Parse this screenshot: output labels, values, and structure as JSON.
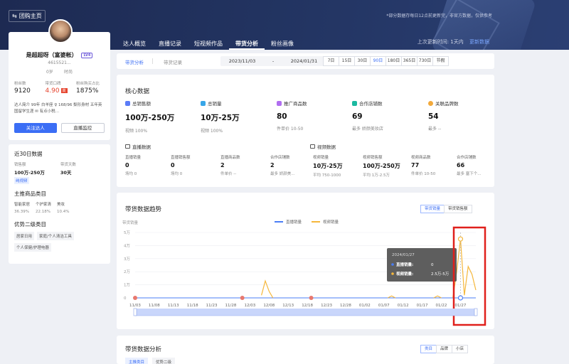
{
  "header": {
    "back_label": "团购主页",
    "notice": "*部分数据存每日12点前更新完，非官方数据，仅供参考",
    "tabs": [
      "达人概览",
      "直播记录",
      "短视频作品",
      "带货分析",
      "粉丝画像"
    ],
    "active_tab": 3,
    "last_update_label": "上次更新时间:",
    "last_update_value": "1天内",
    "update_link": "更新数据"
  },
  "profile": {
    "name": "是超超呀（富婆帐）",
    "level": "LV4",
    "uid": "4615521...",
    "sub_left": "0岁",
    "sub_right": "时尚",
    "stats": [
      {
        "label": "粉丝数",
        "value": "9120"
      },
      {
        "label": "带货口碑",
        "value": "4.90",
        "badge": "高"
      },
      {
        "label": "粉丝购买占比",
        "value": "1875%"
      }
    ],
    "bio": "达人简介 99年 白羊座 ♀ 168/96 梨形身材 五年英国留学生涯 ✉ 有点小税…",
    "follow_btn": "关注达人",
    "live_btn": "直播监控"
  },
  "summary30": {
    "title": "近30日数据",
    "sales_label": "销售额",
    "sales_value": "100万-250万",
    "days_label": "带货天数",
    "days_value": "30天",
    "chip": "纯视频",
    "main_cat_title": "主推商品类目",
    "main_cats": [
      {
        "name": "智能家居",
        "pct": "36.39%"
      },
      {
        "name": "个护家清",
        "pct": "22.18%"
      },
      {
        "name": "美妆",
        "pct": "10.4%"
      }
    ],
    "sub_cat_title": "优势二级类目",
    "sub_cats": [
      "居家日用",
      "家庭/个人清洁工具",
      "个人保健/护理电器"
    ]
  },
  "filter": {
    "tab_active": "带货分析",
    "tab_inactive": "带货记录",
    "date_start": "2023/11/03",
    "date_sep": "-",
    "date_end": "2024/01/31",
    "periods": [
      "7日",
      "15日",
      "30日",
      "90日",
      "180日",
      "365日",
      "730日",
      "节假"
    ],
    "active_period": 3
  },
  "core": {
    "title": "核心数据",
    "metrics": [
      {
        "label": "总销售额",
        "value": "100万-250万",
        "sub": "视频 100%",
        "color": "#5b7cf7"
      },
      {
        "label": "总销量",
        "value": "10万-25万",
        "sub": "视频 100%",
        "color": "#38a6e8"
      },
      {
        "label": "推广商品数",
        "value": "80",
        "sub": "件单价 10-50",
        "color": "#b06ef0"
      },
      {
        "label": "合作店铺数",
        "value": "69",
        "sub": "最多 娇颜美妆店",
        "color": "#1bb9a0"
      },
      {
        "label": "关联品牌数",
        "value": "54",
        "sub": "最多 --",
        "color": "#f2a93b"
      }
    ],
    "live_title": "直播数据",
    "video_title": "视频数据",
    "live": [
      {
        "k": "直播销量",
        "v": "0",
        "s": "场均 0"
      },
      {
        "k": "直播销售额",
        "v": "0",
        "s": "场均 0"
      },
      {
        "k": "直播商品数",
        "v": "2",
        "s": "件单价 --"
      },
      {
        "k": "合作店铺数",
        "v": "2",
        "s": "最多 娇颜美..."
      }
    ],
    "video": [
      {
        "k": "视频销量",
        "v": "10万-25万",
        "s": "平均 750-1000"
      },
      {
        "k": "视频销售额",
        "v": "100万-250万",
        "s": "平均 1万-2.5万"
      },
      {
        "k": "视频商品数",
        "v": "77",
        "s": "件单价 10-50"
      },
      {
        "k": "合作店铺数",
        "v": "66",
        "s": "最多 塞下个..."
      }
    ]
  },
  "trend": {
    "title": "带货数据趋势",
    "toggle": [
      "带货销量",
      "带货销售额"
    ],
    "tooltip": {
      "date": "2024/01/27",
      "rows": [
        {
          "name": "直播销量:",
          "value": "0"
        },
        {
          "name": "视频销量:",
          "value": "2.5万-5万"
        }
      ]
    }
  },
  "chart_data": {
    "type": "line",
    "ylabel": "带货销量",
    "y_ticks": [
      "0",
      "1万",
      "2万",
      "3万",
      "4万",
      "5万"
    ],
    "ylim": [
      0,
      50000
    ],
    "x_ticks": [
      "11/03",
      "11/08",
      "11/13",
      "11/18",
      "11/23",
      "11/28",
      "12/03",
      "12/08",
      "12/13",
      "12/18",
      "12/23",
      "12/28",
      "01/02",
      "01/07",
      "01/12",
      "01/17",
      "01/22",
      "01/27"
    ],
    "x_start": "2023/11/03",
    "x_end": "2024/01/31",
    "series": [
      {
        "name": "直播销量",
        "color": "#4a7df5",
        "points": []
      },
      {
        "name": "视频销量",
        "color": "#f5b73b",
        "points": [
          [
            "12/04",
            0
          ],
          [
            "12/06",
            2000
          ],
          [
            "12/07",
            13000
          ],
          [
            "12/08",
            5000
          ],
          [
            "12/09",
            0
          ],
          [
            "01/08",
            0
          ],
          [
            "01/09",
            1500
          ],
          [
            "01/10",
            0
          ],
          [
            "01/20",
            0
          ],
          [
            "01/21",
            1500
          ],
          [
            "01/22",
            0
          ],
          [
            "01/25",
            0
          ],
          [
            "01/26",
            20000
          ],
          [
            "01/27",
            45000
          ],
          [
            "01/28",
            2000
          ],
          [
            "01/29",
            24000
          ],
          [
            "01/30",
            18000
          ],
          [
            "01/31",
            6000
          ]
        ]
      }
    ],
    "grid": true,
    "legend": "top-center",
    "live_tick_marks": [
      "11/03",
      "12/01",
      "12/19"
    ]
  },
  "analysis": {
    "title": "带货数据分析",
    "toggle": [
      "类目",
      "品牌",
      "小店"
    ],
    "subtabs": [
      "主推类目",
      "优势二级"
    ]
  },
  "colors": {
    "accent": "#3b6ef5",
    "highlight_box": "#e0201c",
    "live_series": "#4a7df5",
    "video_series": "#f5b73b"
  }
}
